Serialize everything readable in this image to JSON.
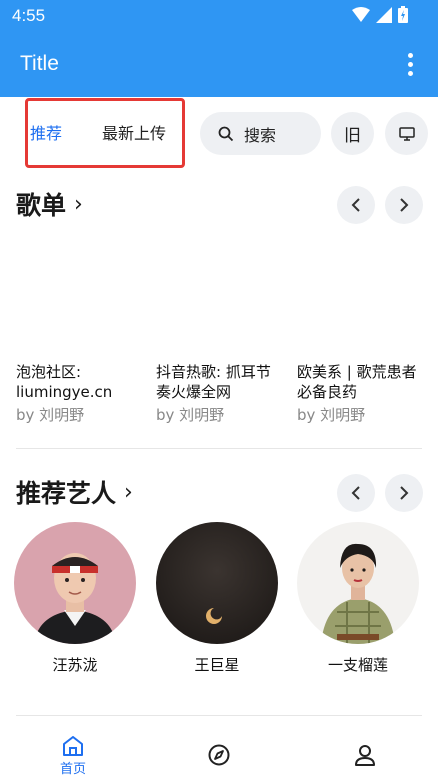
{
  "status_bar": {
    "time": "4:55"
  },
  "app_bar": {
    "title": "Title"
  },
  "tabs": {
    "recommend": "推荐",
    "latest": "最新上传"
  },
  "search": {
    "label": "搜索"
  },
  "buttons": {
    "old_label": "旧"
  },
  "sections": {
    "playlists_title": "歌单",
    "artists_title": "推荐艺人"
  },
  "playlists": [
    {
      "name": "泡泡社区:\nliumingye.cn",
      "by": "by 刘明野"
    },
    {
      "name": "抖音热歌: 抓耳节奏火爆全网",
      "by": "by 刘明野"
    },
    {
      "name": "欧美系 | 歌荒患者必备良药",
      "by": "by 刘明野"
    }
  ],
  "artists": [
    {
      "name": "汪苏泷"
    },
    {
      "name": "王巨星"
    },
    {
      "name": "一支榴莲"
    }
  ],
  "bottom_nav": {
    "home_label": "首页"
  },
  "colors": {
    "app_bar": "#2f96f3",
    "accent": "#1e6ff0",
    "highlight_box": "#e53935"
  }
}
